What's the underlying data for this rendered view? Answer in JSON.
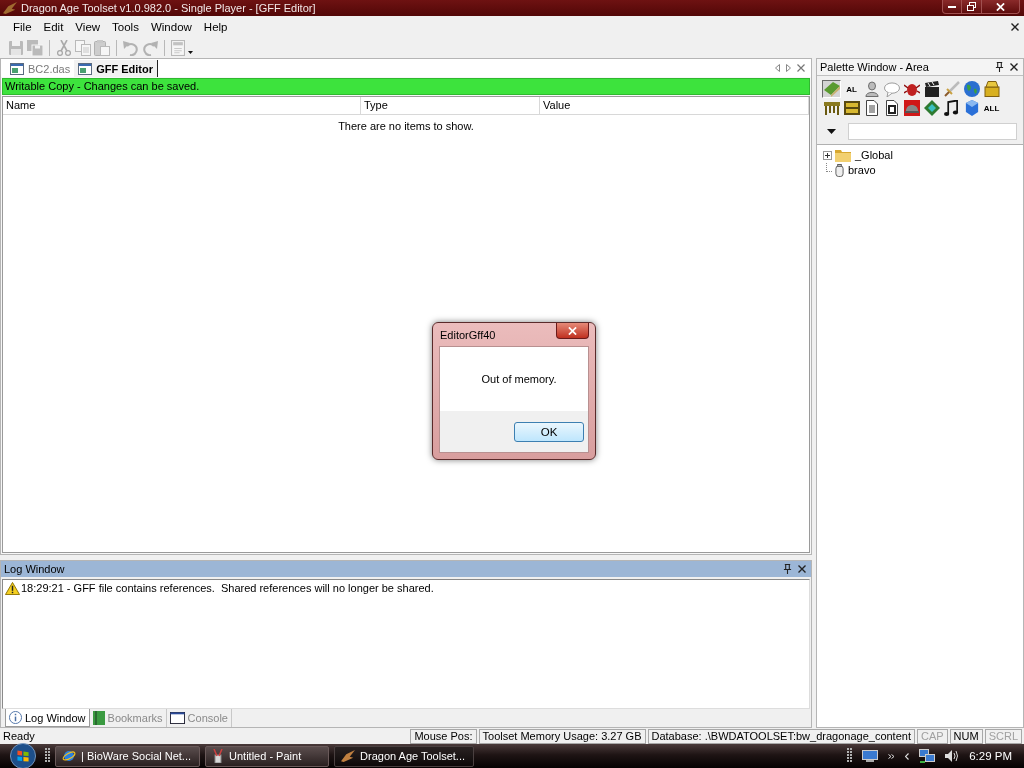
{
  "window": {
    "title": "Dragon Age Toolset v1.0.982.0 - Single Player - [GFF Editor]"
  },
  "menu": [
    "File",
    "Edit",
    "View",
    "Tools",
    "Window",
    "Help"
  ],
  "toolbar": [
    {
      "kind": "save",
      "disabled": true
    },
    {
      "kind": "save-all",
      "disabled": true
    },
    {
      "kind": "separator"
    },
    {
      "kind": "cut",
      "disabled": true
    },
    {
      "kind": "copy",
      "disabled": true
    },
    {
      "kind": "paste",
      "disabled": true
    },
    {
      "kind": "separator"
    },
    {
      "kind": "undo",
      "disabled": true
    },
    {
      "kind": "redo",
      "disabled": true
    },
    {
      "kind": "separator"
    },
    {
      "kind": "properties",
      "disabled": true
    }
  ],
  "document_tabs": [
    {
      "label": "BC2.das",
      "selected": false
    },
    {
      "label": "GFF Editor",
      "selected": true
    }
  ],
  "editor": {
    "notice": "Writable Copy - Changes can be saved.",
    "table": {
      "columns": [
        "Name",
        "Type",
        "Value"
      ],
      "empty_message": "There are no items to show."
    }
  },
  "palette": {
    "title": "Palette Window - Area",
    "tools": [
      {
        "kind": "book",
        "selected": true
      },
      {
        "kind": "text",
        "label": "AL",
        "selected": false
      },
      {
        "kind": "person",
        "selected": false
      },
      {
        "kind": "speech",
        "selected": false
      },
      {
        "kind": "bug",
        "selected": false
      },
      {
        "kind": "clapper",
        "selected": false
      },
      {
        "kind": "sword",
        "selected": false
      },
      {
        "kind": "globe",
        "selected": false
      },
      {
        "kind": "chest",
        "selected": false
      },
      {
        "kind": "table",
        "selected": false
      },
      {
        "kind": "box",
        "selected": false
      },
      {
        "kind": "document",
        "selected": false
      },
      {
        "kind": "script",
        "selected": false
      },
      {
        "kind": "dome",
        "selected": false
      },
      {
        "kind": "diamond",
        "selected": false
      },
      {
        "kind": "note",
        "selected": false
      },
      {
        "kind": "cube",
        "selected": false
      },
      {
        "kind": "text",
        "label": "ALL",
        "selected": false
      }
    ],
    "tree": [
      {
        "label": "_Global",
        "kind": "folder",
        "expanded": false
      },
      {
        "label": "bravo",
        "kind": "object"
      }
    ]
  },
  "log_window": {
    "title": "Log Window",
    "entries": [
      {
        "kind": "warning",
        "text": "18:29:21 - GFF file contains references.  Shared references will no longer be shared."
      }
    ],
    "tabs": [
      {
        "label": "Log Window",
        "kind": "info",
        "selected": true
      },
      {
        "label": "Bookmarks",
        "kind": "bookmarks",
        "selected": false
      },
      {
        "label": "Console",
        "kind": "console",
        "selected": false
      }
    ]
  },
  "status_bar": {
    "message": "Ready",
    "panels": [
      {
        "text": "Mouse Pos:",
        "disabled": false
      },
      {
        "text": "Toolset Memory Usage: 3.27 GB",
        "disabled": false
      },
      {
        "text": "Database: .\\BWDATOOLSET:bw_dragonage_content",
        "disabled": false
      },
      {
        "text": "CAP",
        "disabled": true
      },
      {
        "text": "NUM",
        "disabled": false
      },
      {
        "text": "SCRL",
        "disabled": true
      }
    ]
  },
  "taskbar": {
    "buttons": [
      {
        "label": "| BioWare Social Net...",
        "kind": "browser",
        "selected": false
      },
      {
        "label": "Untitled - Paint",
        "kind": "paint",
        "selected": false
      },
      {
        "label": "Dragon Age Toolset...",
        "kind": "toolset",
        "selected": true
      }
    ],
    "clock": "6:29 PM"
  },
  "dialog": {
    "title": "EditorGff40",
    "message": "Out of memory.",
    "buttons": [
      "OK"
    ]
  }
}
